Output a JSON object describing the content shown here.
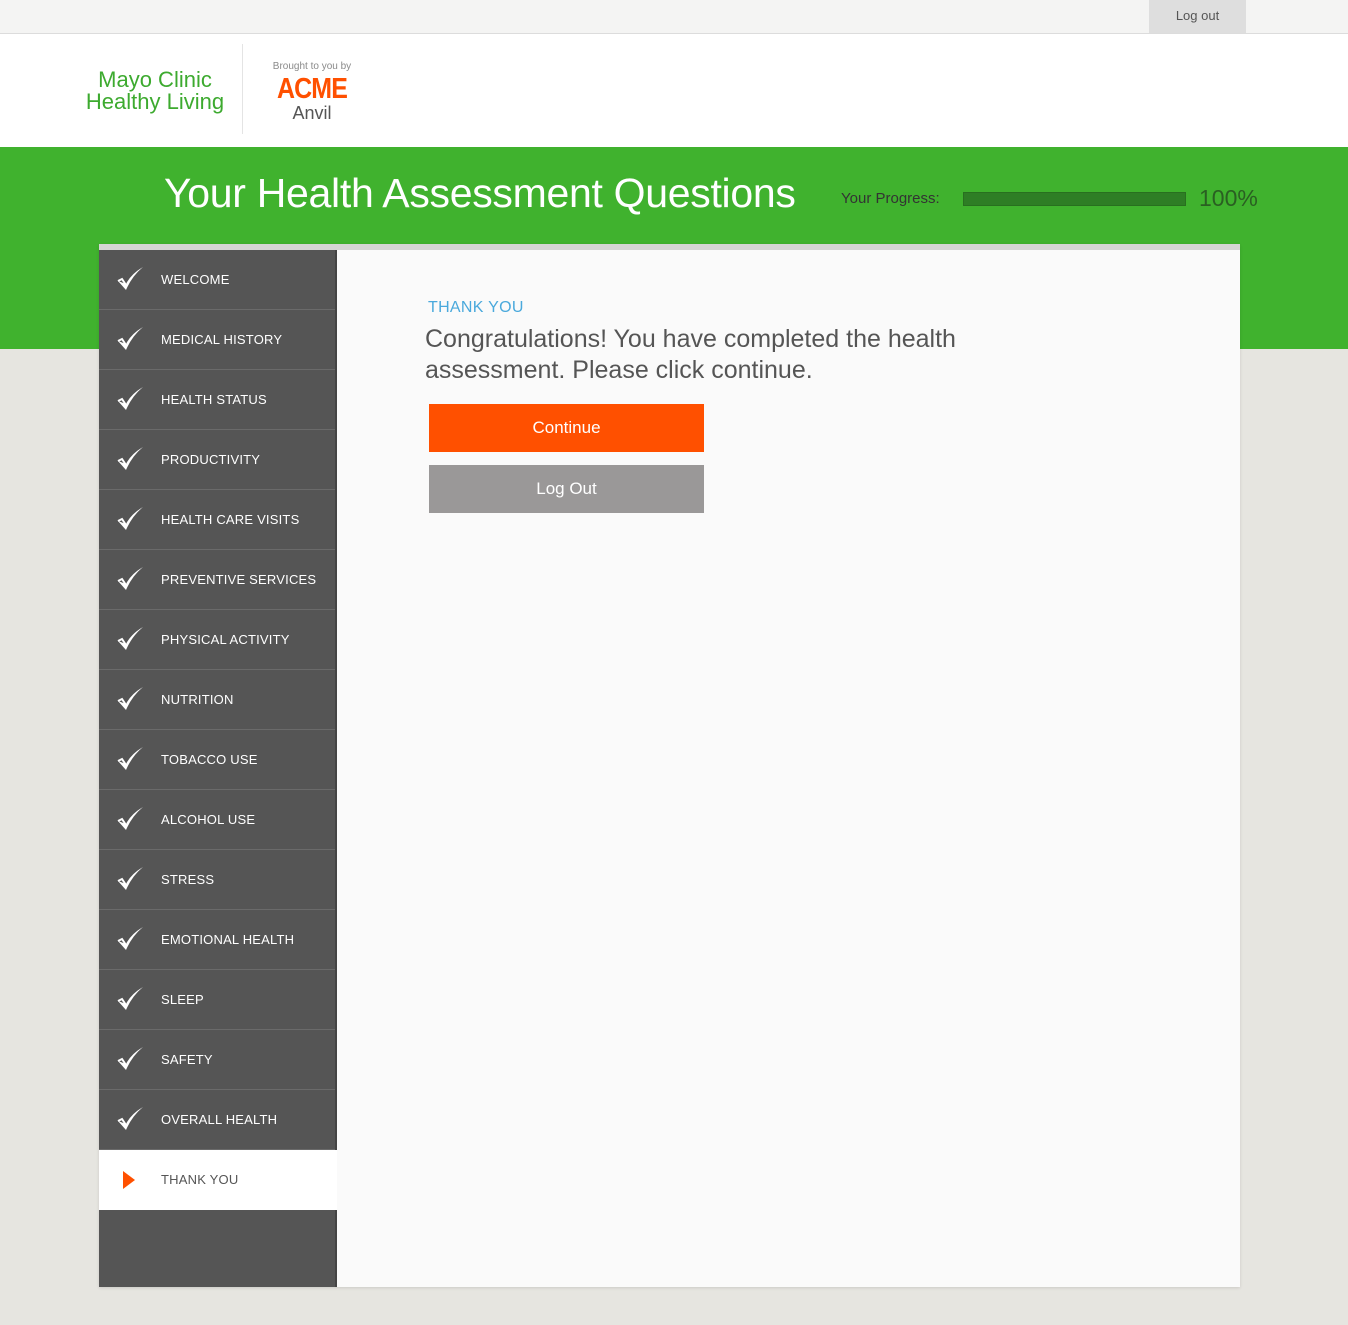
{
  "topbar": {
    "logout_label": "Log out"
  },
  "header": {
    "logo_line1": "Mayo Clinic",
    "logo_line2": "Healthy Living",
    "brought_by": "Brought to you by",
    "sponsor_name": "ACME",
    "sponsor_sub": "Anvil"
  },
  "page": {
    "title": "Your Health Assessment Questions",
    "progress_label": "Your Progress:",
    "progress_value": 100,
    "progress_text": "100%"
  },
  "sidebar": {
    "items": [
      {
        "label": "WELCOME",
        "status": "complete"
      },
      {
        "label": "MEDICAL HISTORY",
        "status": "complete"
      },
      {
        "label": "HEALTH STATUS",
        "status": "complete"
      },
      {
        "label": "PRODUCTIVITY",
        "status": "complete"
      },
      {
        "label": "HEALTH CARE VISITS",
        "status": "complete"
      },
      {
        "label": "PREVENTIVE SERVICES",
        "status": "complete"
      },
      {
        "label": "PHYSICAL ACTIVITY",
        "status": "complete"
      },
      {
        "label": "NUTRITION",
        "status": "complete"
      },
      {
        "label": "TOBACCO USE",
        "status": "complete"
      },
      {
        "label": "ALCOHOL USE",
        "status": "complete"
      },
      {
        "label": "STRESS",
        "status": "complete"
      },
      {
        "label": "EMOTIONAL HEALTH",
        "status": "complete"
      },
      {
        "label": "SLEEP",
        "status": "complete"
      },
      {
        "label": "SAFETY",
        "status": "complete"
      },
      {
        "label": "OVERALL HEALTH",
        "status": "complete"
      },
      {
        "label": "THANK YOU",
        "status": "current"
      }
    ]
  },
  "main": {
    "section_label": "THANK YOU",
    "message": "Congratulations! You have completed the health assessment. Please click continue.",
    "continue_label": "Continue",
    "logout_label": "Log Out"
  },
  "colors": {
    "brand_green": "#40b22e",
    "accent_orange": "#ff5000",
    "sidebar_gray": "#555555",
    "link_blue": "#4aa9dc"
  }
}
